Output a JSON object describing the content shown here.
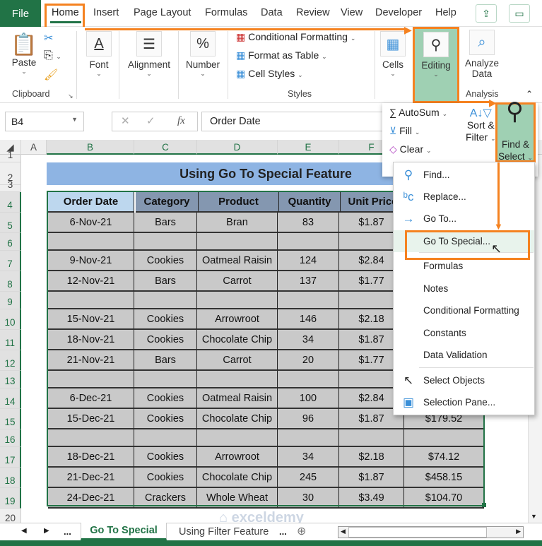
{
  "ribbon_tabs": {
    "file": "File",
    "tabs": [
      "Home",
      "Insert",
      "Page Layout",
      "Formulas",
      "Data",
      "Review",
      "View",
      "Developer",
      "Help"
    ],
    "active": "Home"
  },
  "ribbon": {
    "clipboard": {
      "paste": "Paste",
      "group": "Clipboard"
    },
    "font": "Font",
    "alignment": "Alignment",
    "number": "Number",
    "styles": {
      "conditional": "Conditional Formatting",
      "format_table": "Format as Table",
      "cell_styles": "Cell Styles",
      "group": "Styles"
    },
    "cells": "Cells",
    "editing": "Editing",
    "analyze": {
      "label1": "Analyze",
      "label2": "Data",
      "group": "Analysis"
    }
  },
  "editing_menu": {
    "autosum": "AutoSum",
    "fill": "Fill",
    "clear": "Clear",
    "sort1": "Sort &",
    "sort2": "Filter",
    "find1": "Find &",
    "find2": "Select"
  },
  "formula_bar": {
    "name_box": "B4",
    "fx": "fx",
    "value": "Order Date"
  },
  "columns": [
    "A",
    "B",
    "C",
    "D",
    "E",
    "F"
  ],
  "sheet": {
    "title": "Using Go To Special Feature",
    "headers": [
      "Order Date",
      "Category",
      "Product",
      "Quantity",
      "Unit Price",
      ""
    ],
    "rows": [
      {
        "n": "5",
        "cells": [
          "6-Nov-21",
          "Bars",
          "Bran",
          "83",
          "$1.87",
          ""
        ]
      },
      {
        "n": "6",
        "cells": [
          "",
          "",
          "",
          "",
          "",
          ""
        ]
      },
      {
        "n": "7",
        "cells": [
          "9-Nov-21",
          "Cookies",
          "Oatmeal Raisin",
          "124",
          "$2.84",
          ""
        ]
      },
      {
        "n": "8",
        "cells": [
          "12-Nov-21",
          "Bars",
          "Carrot",
          "137",
          "$1.77",
          ""
        ]
      },
      {
        "n": "9",
        "cells": [
          "",
          "",
          "",
          "",
          "",
          ""
        ]
      },
      {
        "n": "10",
        "cells": [
          "15-Nov-21",
          "Cookies",
          "Arrowroot",
          "146",
          "$2.18",
          ""
        ]
      },
      {
        "n": "11",
        "cells": [
          "18-Nov-21",
          "Cookies",
          "Chocolate Chip",
          "34",
          "$1.87",
          ""
        ]
      },
      {
        "n": "12",
        "cells": [
          "21-Nov-21",
          "Bars",
          "Carrot",
          "20",
          "$1.77",
          ""
        ]
      },
      {
        "n": "13",
        "cells": [
          "",
          "",
          "",
          "",
          "",
          ""
        ]
      },
      {
        "n": "14",
        "cells": [
          "6-Dec-21",
          "Cookies",
          "Oatmeal Raisin",
          "100",
          "$2.84",
          ""
        ]
      },
      {
        "n": "15",
        "cells": [
          "15-Dec-21",
          "Cookies",
          "Chocolate Chip",
          "96",
          "$1.87",
          "$179.52"
        ]
      },
      {
        "n": "16",
        "cells": [
          "",
          "",
          "",
          "",
          "",
          ""
        ]
      },
      {
        "n": "17",
        "cells": [
          "18-Dec-21",
          "Cookies",
          "Arrowroot",
          "34",
          "$2.18",
          "$74.12"
        ]
      },
      {
        "n": "18",
        "cells": [
          "21-Dec-21",
          "Cookies",
          "Chocolate Chip",
          "245",
          "$1.87",
          "$458.15"
        ]
      },
      {
        "n": "19",
        "cells": [
          "24-Dec-21",
          "Crackers",
          "Whole Wheat",
          "30",
          "$3.49",
          "$104.70"
        ]
      }
    ]
  },
  "row_labels": {
    "r1": "1",
    "r2": "2",
    "r3": "3",
    "r4": "4",
    "r20": "20"
  },
  "find_menu": [
    {
      "label": "Find...",
      "icon": "search-icon"
    },
    {
      "label": "Replace...",
      "icon": "replace-icon"
    },
    {
      "label": "Go To...",
      "icon": "arrow-right-icon"
    },
    {
      "label": "Go To Special...",
      "icon": "",
      "highlighted": true
    },
    {
      "label": "Formulas",
      "icon": ""
    },
    {
      "label": "Notes",
      "icon": ""
    },
    {
      "label": "Conditional Formatting",
      "icon": ""
    },
    {
      "label": "Constants",
      "icon": ""
    },
    {
      "label": "Data Validation",
      "icon": ""
    },
    {
      "label": "Select Objects",
      "icon": "cursor-icon"
    },
    {
      "label": "Selection Pane...",
      "icon": "selection-pane-icon"
    }
  ],
  "sheet_tabs": {
    "ellipsis": "...",
    "active": "Go To Special",
    "other": "Using Filter Feature",
    "more": "..."
  },
  "watermark": "exceldemy",
  "colors": {
    "excel_green": "#217346",
    "highlight_orange": "#f58220",
    "title_fill": "#8eb4e3",
    "header_fill": "#8497b0",
    "cell_fill": "#c9c9c9",
    "editing_fill": "#9fd0b3"
  }
}
